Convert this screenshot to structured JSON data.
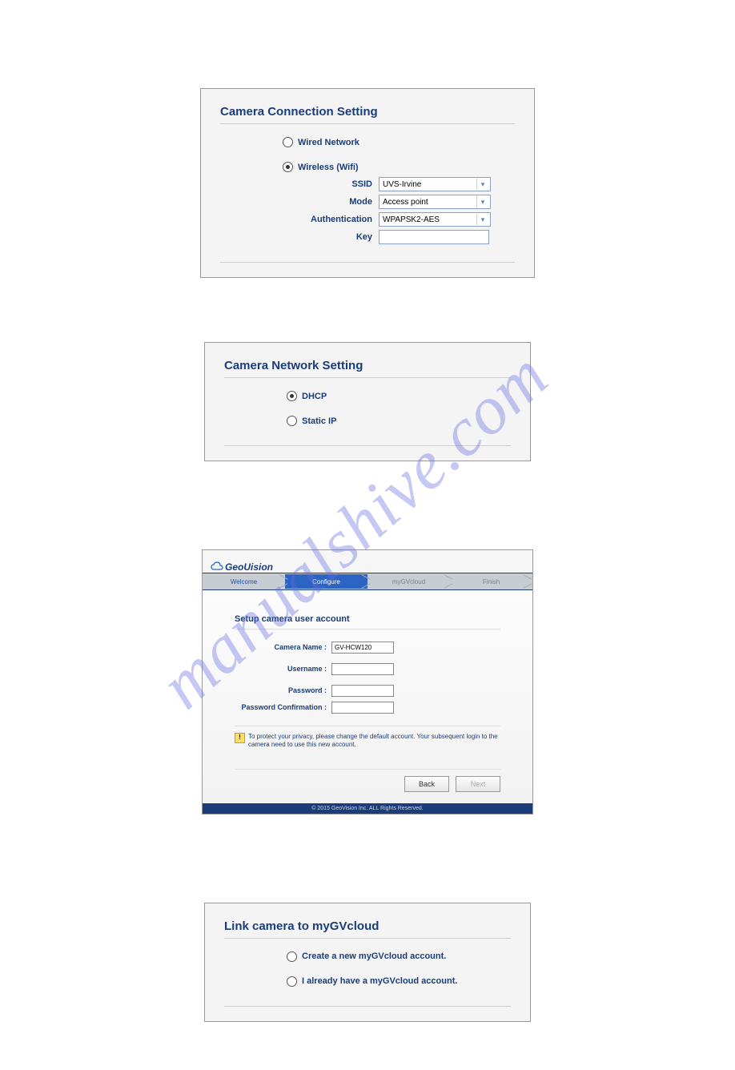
{
  "watermark": "manualshive.com",
  "panel1": {
    "title": "Camera Connection Setting",
    "wired_label": "Wired Network",
    "wireless_label": "Wireless (Wifi)",
    "ssid_label": "SSID",
    "ssid_value": "UVS-Irvine",
    "mode_label": "Mode",
    "mode_value": "Access point",
    "auth_label": "Authentication",
    "auth_value": "WPAPSK2-AES",
    "key_label": "Key",
    "key_value": ""
  },
  "panel2": {
    "title": "Camera Network Setting",
    "dhcp_label": "DHCP",
    "static_label": "Static IP"
  },
  "panel3": {
    "brand": "GeoUision",
    "steps": {
      "s1": "Welcome",
      "s2": "Configure",
      "s3": "myGVcloud",
      "s4": "Finish"
    },
    "section_title": "Setup camera user account",
    "camera_name_label": "Camera Name :",
    "camera_name_value": "GV-HCW120",
    "username_label": "Username :",
    "password_label": "Password :",
    "password_conf_label": "Password Confirmation :",
    "note": "To protect your privacy, please change the default account. Your subsequent login to the camera need to use this new account.",
    "back_label": "Back",
    "next_label": "Next",
    "footer": "© 2015 GeoVision Inc. ALL Rights Reserved."
  },
  "panel4": {
    "title": "Link camera to myGVcloud",
    "create_label": "Create a new myGVcloud account.",
    "have_label": "I already have a myGVcloud account."
  }
}
